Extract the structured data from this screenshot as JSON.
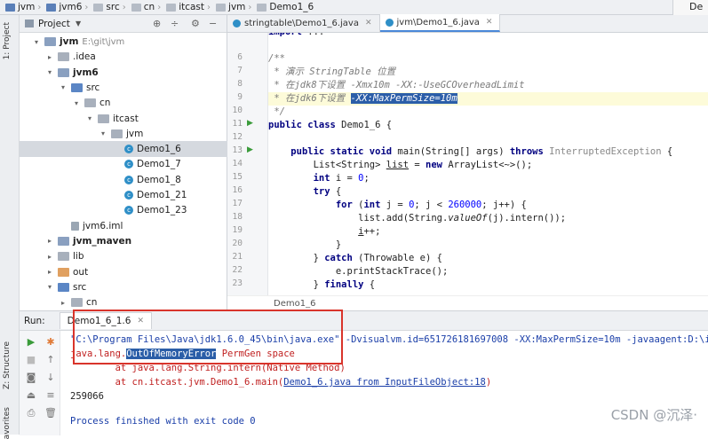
{
  "breadcrumb": {
    "items": [
      "jvm",
      "jvm6",
      "src",
      "cn",
      "itcast",
      "jvm",
      "Demo1_6"
    ],
    "right_label": "De"
  },
  "left_strip": {
    "project_tab": "1: Project",
    "structure_tab": "Z: Structure",
    "favorites_tab": "avorites"
  },
  "project_panel": {
    "title": "Project",
    "tree": [
      {
        "label": "jvm",
        "hint": "E:\\git\\jvm",
        "bold": true,
        "arrow": "▾",
        "indent": 0,
        "icon": "fm"
      },
      {
        "label": ".idea",
        "hint": "",
        "bold": false,
        "arrow": "▸",
        "indent": 1,
        "icon": "f"
      },
      {
        "label": "jvm6",
        "hint": "",
        "bold": true,
        "arrow": "▾",
        "indent": 1,
        "icon": "fm"
      },
      {
        "label": "src",
        "hint": "",
        "bold": false,
        "arrow": "▾",
        "indent": 2,
        "icon": "fb"
      },
      {
        "label": "cn",
        "hint": "",
        "bold": false,
        "arrow": "▾",
        "indent": 3,
        "icon": "f"
      },
      {
        "label": "itcast",
        "hint": "",
        "bold": false,
        "arrow": "▾",
        "indent": 4,
        "icon": "f"
      },
      {
        "label": "jvm",
        "hint": "",
        "bold": false,
        "arrow": "▾",
        "indent": 5,
        "icon": "f"
      },
      {
        "label": "Demo1_6",
        "hint": "",
        "bold": false,
        "arrow": "",
        "indent": 6,
        "icon": "c",
        "selected": true
      },
      {
        "label": "Demo1_7",
        "hint": "",
        "bold": false,
        "arrow": "",
        "indent": 6,
        "icon": "c"
      },
      {
        "label": "Demo1_8",
        "hint": "",
        "bold": false,
        "arrow": "",
        "indent": 6,
        "icon": "c"
      },
      {
        "label": "Demo1_21",
        "hint": "",
        "bold": false,
        "arrow": "",
        "indent": 6,
        "icon": "c"
      },
      {
        "label": "Demo1_23",
        "hint": "",
        "bold": false,
        "arrow": "",
        "indent": 6,
        "icon": "c"
      },
      {
        "label": "jvm6.iml",
        "hint": "",
        "bold": false,
        "arrow": "",
        "indent": 2,
        "icon": "iml"
      },
      {
        "label": "jvm_maven",
        "hint": "",
        "bold": true,
        "arrow": "▸",
        "indent": 1,
        "icon": "fm"
      },
      {
        "label": "lib",
        "hint": "",
        "bold": false,
        "arrow": "▸",
        "indent": 1,
        "icon": "f"
      },
      {
        "label": "out",
        "hint": "",
        "bold": false,
        "arrow": "▸",
        "indent": 1,
        "icon": "fo"
      },
      {
        "label": "src",
        "hint": "",
        "bold": false,
        "arrow": "▾",
        "indent": 1,
        "icon": "fb"
      },
      {
        "label": "cn",
        "hint": "",
        "bold": false,
        "arrow": "▸",
        "indent": 2,
        "icon": "f"
      }
    ]
  },
  "editor": {
    "tabs": [
      {
        "label": "stringtable\\Demo1_6.java",
        "active": false
      },
      {
        "label": "jvm\\Demo1_6.java",
        "active": true
      }
    ],
    "footer_label": "Demo1_6",
    "line_numbers": [
      "6",
      "7",
      "8",
      "9",
      "10",
      "11",
      "12",
      "13",
      "14",
      "15",
      "16",
      "17",
      "18",
      "19",
      "20",
      "21",
      "22",
      "23"
    ]
  },
  "run_panel": {
    "label": "Run:",
    "tab_label": "Demo1_6_1.6",
    "output": {
      "cmd_line": "\"C:\\Program Files\\Java\\jdk1.6.0_45\\bin\\java.exe\" -Dvisualvm.id=651726181697008 -XX:MaxPermSize=10m -javaagent:D:\\i",
      "err_prefix": "java.lang.",
      "err_name": "OutOfMemoryError",
      "err_suffix": " PermGen space",
      "trace1": "\tat java.lang.String.intern(Native Method)",
      "trace2_prefix": "\tat cn.itcast.jvm.Demo1_6.main(",
      "trace2_link": "Demo1_6.java from InputFileObject:18",
      "trace2_suffix": ")",
      "count": "259066",
      "finished": "Process finished with exit code 0"
    }
  },
  "watermark": "CSDN @沉泽·"
}
